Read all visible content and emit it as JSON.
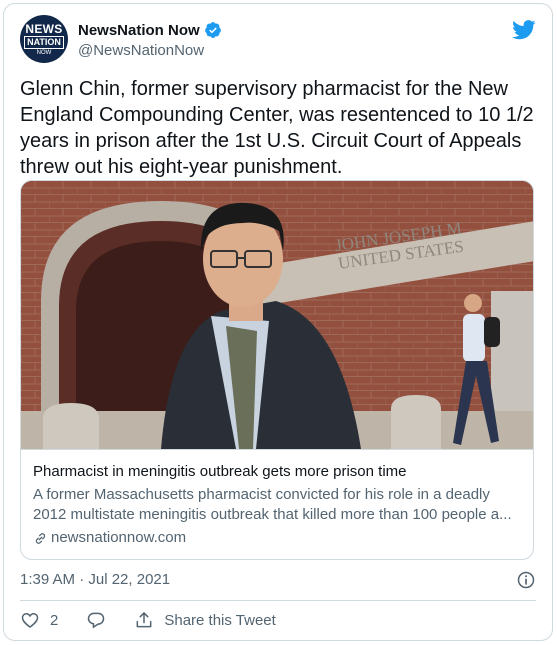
{
  "author": {
    "avatar_text": [
      "NEWS",
      "NATION",
      "NOW"
    ],
    "display_name": "NewsNation Now",
    "handle": "@NewsNationNow",
    "verified": true,
    "avatar_color": "#12284b"
  },
  "tweet": {
    "text": "Glenn Chin, former supervisory pharmacist for the New England Compounding Center, was resentenced to 10 1/2 years in prison after the 1st U.S. Circuit Court of Appeals threw out his eight-year punishment.",
    "timestamp": "1:39 AM · Jul 22, 2021"
  },
  "link_card": {
    "image_sign_text": [
      "JOHN JOSEPH M",
      "UNITED STATES"
    ],
    "title": "Pharmacist in meningitis outbreak gets more prison time",
    "description": "A former Massachusetts pharmacist convicted for his role in a deadly 2012 multistate meningitis outbreak that killed more than 100 people a...",
    "domain": "newsnationnow.com"
  },
  "actions": {
    "like_count": "2",
    "share_label": "Share this Tweet"
  },
  "icons": {
    "logo": "twitter-logo-icon",
    "verified": "verified-badge-icon",
    "info": "info-icon",
    "like": "heart-icon",
    "reply": "reply-icon",
    "share": "share-icon",
    "link": "link-icon"
  },
  "colors": {
    "brand_blue": "#1d9bf0",
    "text_primary": "#0f1419",
    "text_secondary": "#536471",
    "border": "#cfd9de"
  }
}
